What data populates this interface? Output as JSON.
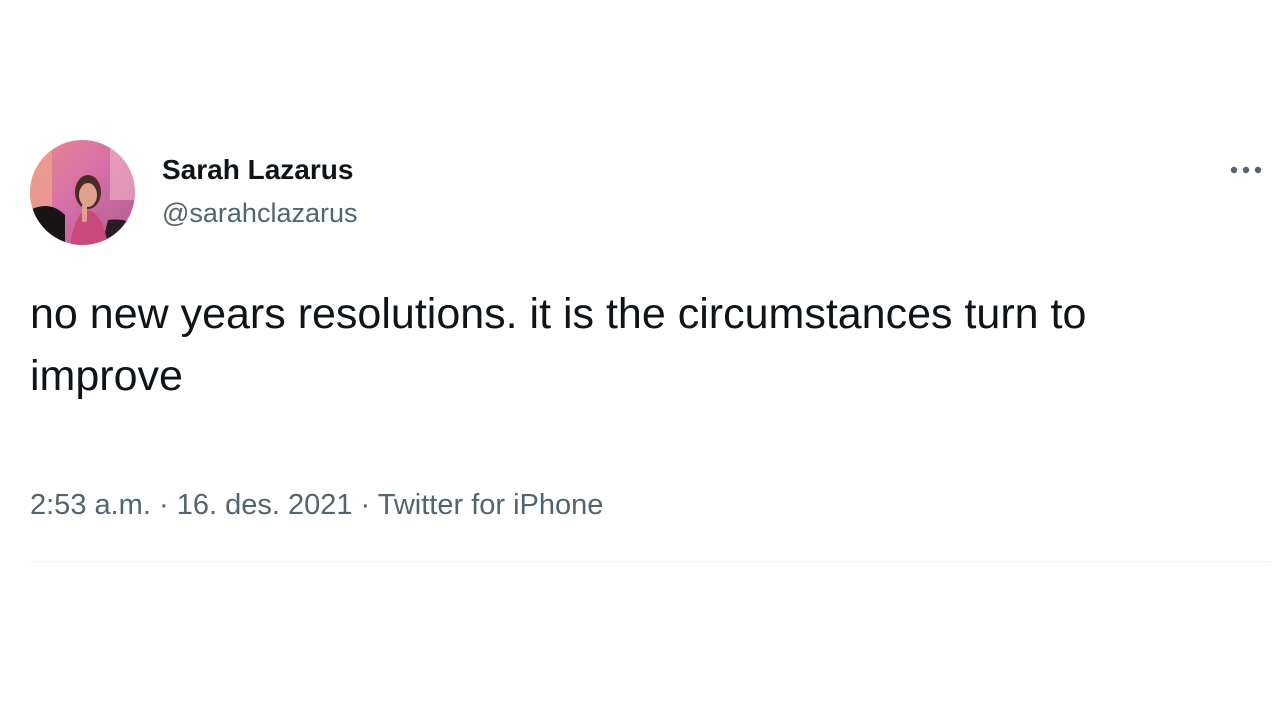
{
  "tweet": {
    "author": {
      "display_name": "Sarah Lazarus",
      "handle": "@sarahclazarus"
    },
    "text": "no new years resolutions. it is the circumstances turn to improve",
    "meta": {
      "time": "2:53 a.m.",
      "separator": "·",
      "date": "16. des. 2021",
      "source": "Twitter for iPhone"
    },
    "more_icon": "more-dots-icon"
  },
  "colors": {
    "primary_text": "#0f1419",
    "secondary_text": "#536471",
    "divider": "#eff3f4",
    "background": "#ffffff"
  }
}
